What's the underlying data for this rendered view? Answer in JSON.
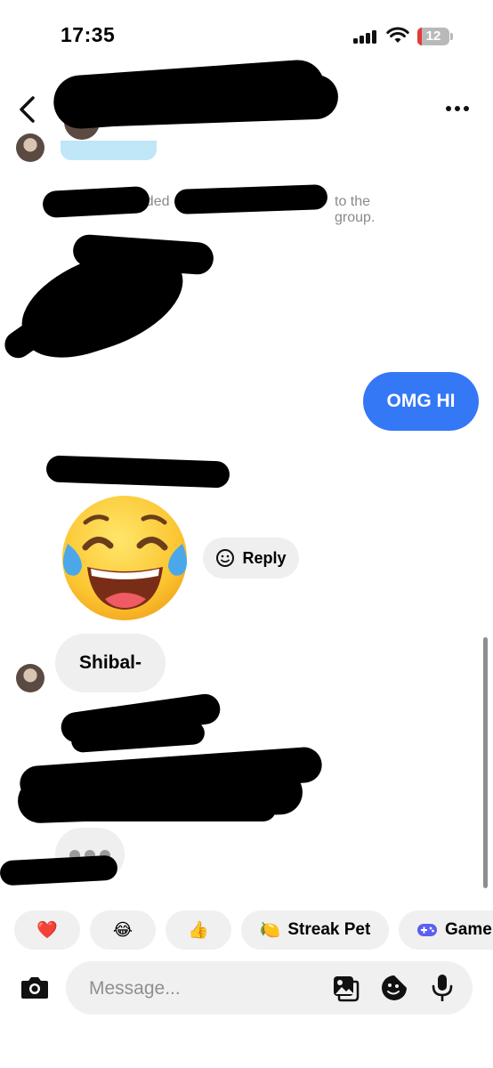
{
  "status_bar": {
    "time": "17:35",
    "battery_level": "12",
    "icons": [
      "signal-icon",
      "wifi-icon",
      "battery-icon"
    ]
  },
  "header": {
    "icons": [
      "back-arrow-icon",
      "group-avatar",
      "more-options-icon"
    ]
  },
  "messages": {
    "system_added": "added",
    "system_tail": "to the group.",
    "outgoing_1": "OMG HI",
    "reaction_emoji": "😂",
    "reply_label": "Reply",
    "incoming_1": "Shibal-"
  },
  "quick_reactions": [
    {
      "emoji": "❤️"
    },
    {
      "emoji": "😂"
    },
    {
      "emoji": "👍"
    },
    {
      "emoji": "🍋",
      "label": "Streak Pet"
    },
    {
      "icon": "game-controller-icon",
      "label": "Game"
    }
  ],
  "composer": {
    "placeholder": "Message...",
    "icons": [
      "camera-icon",
      "gallery-icon",
      "sticker-icon",
      "microphone-icon"
    ]
  },
  "colors": {
    "accent": "#3478F6",
    "bubble_gray": "#EFEFEF",
    "text_gray": "#8A8A8A"
  }
}
